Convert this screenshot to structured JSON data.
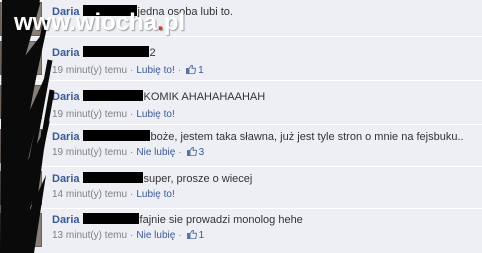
{
  "watermark": {
    "prefix": "www.wiocha",
    "dot": ".",
    "suffix": "pl"
  },
  "comments": [
    {
      "author": "Daria",
      "text": "jedna osoba lubi to.",
      "time": "",
      "like_link": "",
      "likes": ""
    },
    {
      "author": "Daria",
      "text": "2",
      "time": "19 minut(y) temu",
      "like_link": "Lubię to!",
      "likes": "1"
    },
    {
      "author": "Daria",
      "text": "KOMIK AHAHAHAAHAH",
      "time": "19 minut(y) temu",
      "like_link": "Lubię to!",
      "likes": ""
    },
    {
      "author": "Daria",
      "text": "boże, jestem taka sławna, już jest tyle stron o mnie na fejsbuku..",
      "time": "19 minut(y) temu",
      "like_link": "Nie lubię",
      "likes": "3"
    },
    {
      "author": "Daria",
      "text": "super, prosze o wiecej",
      "time": "14 minut(y) temu",
      "like_link": "Lubię to!",
      "likes": ""
    },
    {
      "author": "Daria",
      "text": "fajnie sie prowadzi monolog hehe",
      "time": "13 minut(y) temu",
      "like_link": "Nie lubię",
      "likes": "1"
    }
  ],
  "colors": {
    "background": "#edeff4",
    "link": "#3b5998",
    "meta": "#808080",
    "text": "#333333",
    "redaction": "#000000"
  }
}
